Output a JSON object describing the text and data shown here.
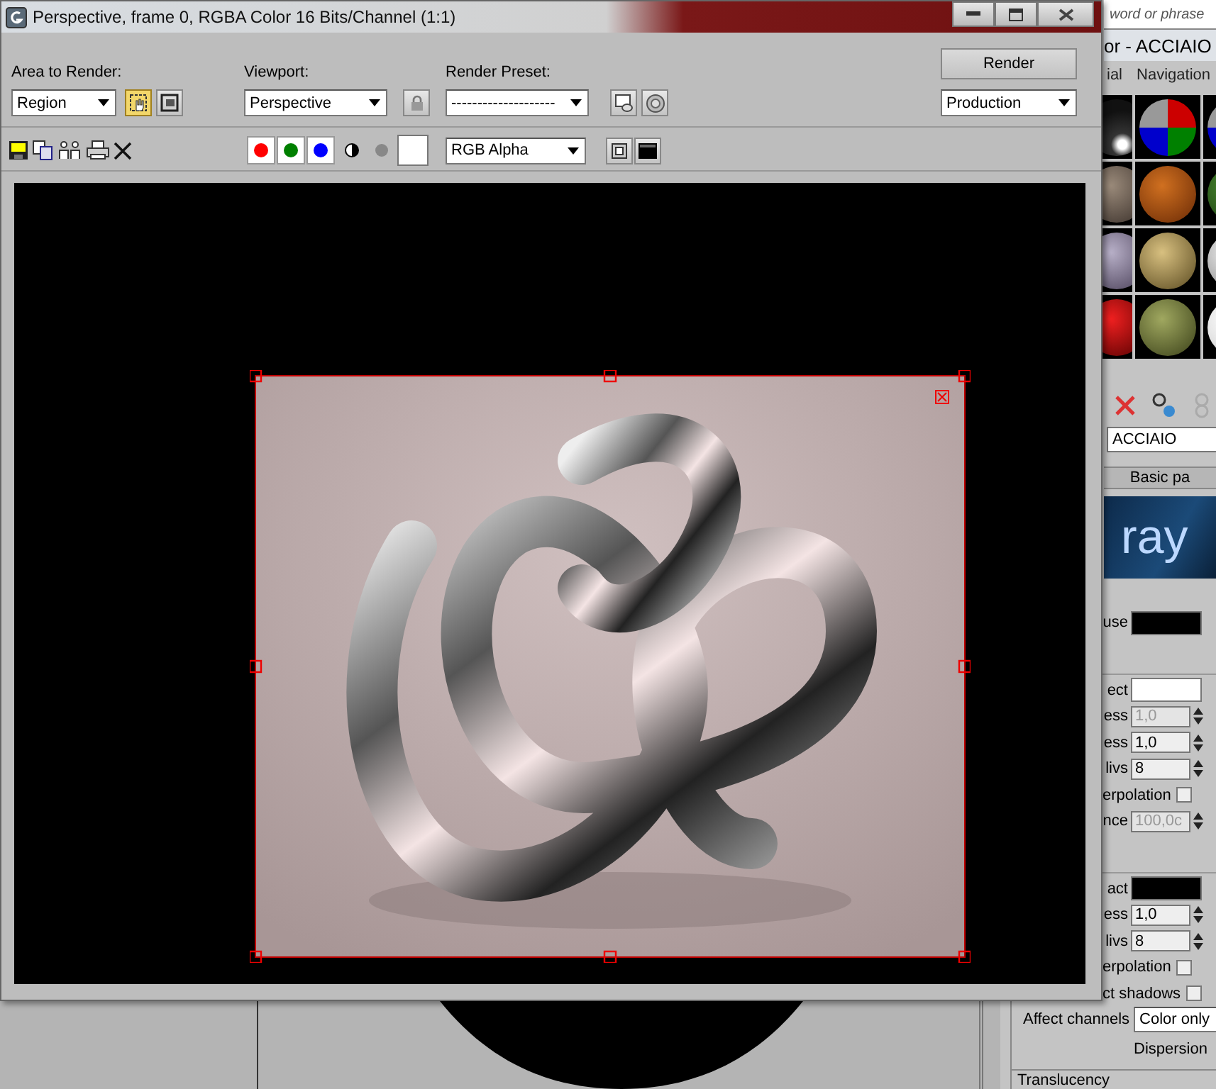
{
  "render_window": {
    "title": "Perspective, frame 0, RGBA Color 16 Bits/Channel (1:1)",
    "area_to_render": {
      "label": "Area to Render:",
      "value": "Region",
      "region_edit_on": true
    },
    "viewport": {
      "label": "Viewport:",
      "value": "Perspective"
    },
    "render_preset": {
      "label": "Render Preset:",
      "value": "--------------------"
    },
    "render_button": "Render",
    "render_mode": "Production",
    "channels": [
      {
        "color": "#ff0000",
        "on": true
      },
      {
        "color": "#008000",
        "on": true
      },
      {
        "color": "#0000ff",
        "on": true
      }
    ],
    "display_channel": "RGB Alpha"
  },
  "material_editor": {
    "search_placeholder": "word or phrase",
    "title": "or - ACCIAIO",
    "menu": [
      "ial",
      "Navigation"
    ],
    "material_name": "ACCIAIO",
    "rollout": "Basic pa",
    "banner": "ray",
    "groups": [
      {
        "rows": [
          {
            "kind": "swatch",
            "label": "use",
            "color": "#000000"
          }
        ]
      },
      {
        "rows": [
          {
            "kind": "swatch",
            "label": "ect",
            "color": "#ffffff"
          },
          {
            "kind": "spinner",
            "label": "ess",
            "value": "1,0",
            "disabled": true
          },
          {
            "kind": "spinner",
            "label": "ess",
            "value": "1,0",
            "disabled": false
          },
          {
            "kind": "spinner",
            "label": "livs",
            "value": "8",
            "disabled": false
          },
          {
            "kind": "checkbox",
            "label": "erpolation",
            "checked": false
          },
          {
            "kind": "spinner",
            "label": "nce",
            "value": "100,0c",
            "disabled": true
          }
        ]
      },
      {
        "rows": [
          {
            "kind": "swatch",
            "label": "act",
            "color": "#000000"
          },
          {
            "kind": "spinner",
            "label": "ess",
            "value": "1,0",
            "disabled": false
          },
          {
            "kind": "spinner",
            "label": "livs",
            "value": "8",
            "disabled": false
          },
          {
            "kind": "checkbox",
            "label": "erpolation",
            "checked": false
          },
          {
            "kind": "checkbox",
            "label": "ct shadows",
            "checked": false
          }
        ]
      }
    ],
    "affect_channels": {
      "label": "Affect channels",
      "value": "Color only"
    },
    "dispersion": "Dispersion",
    "translucency": "Translucency"
  }
}
